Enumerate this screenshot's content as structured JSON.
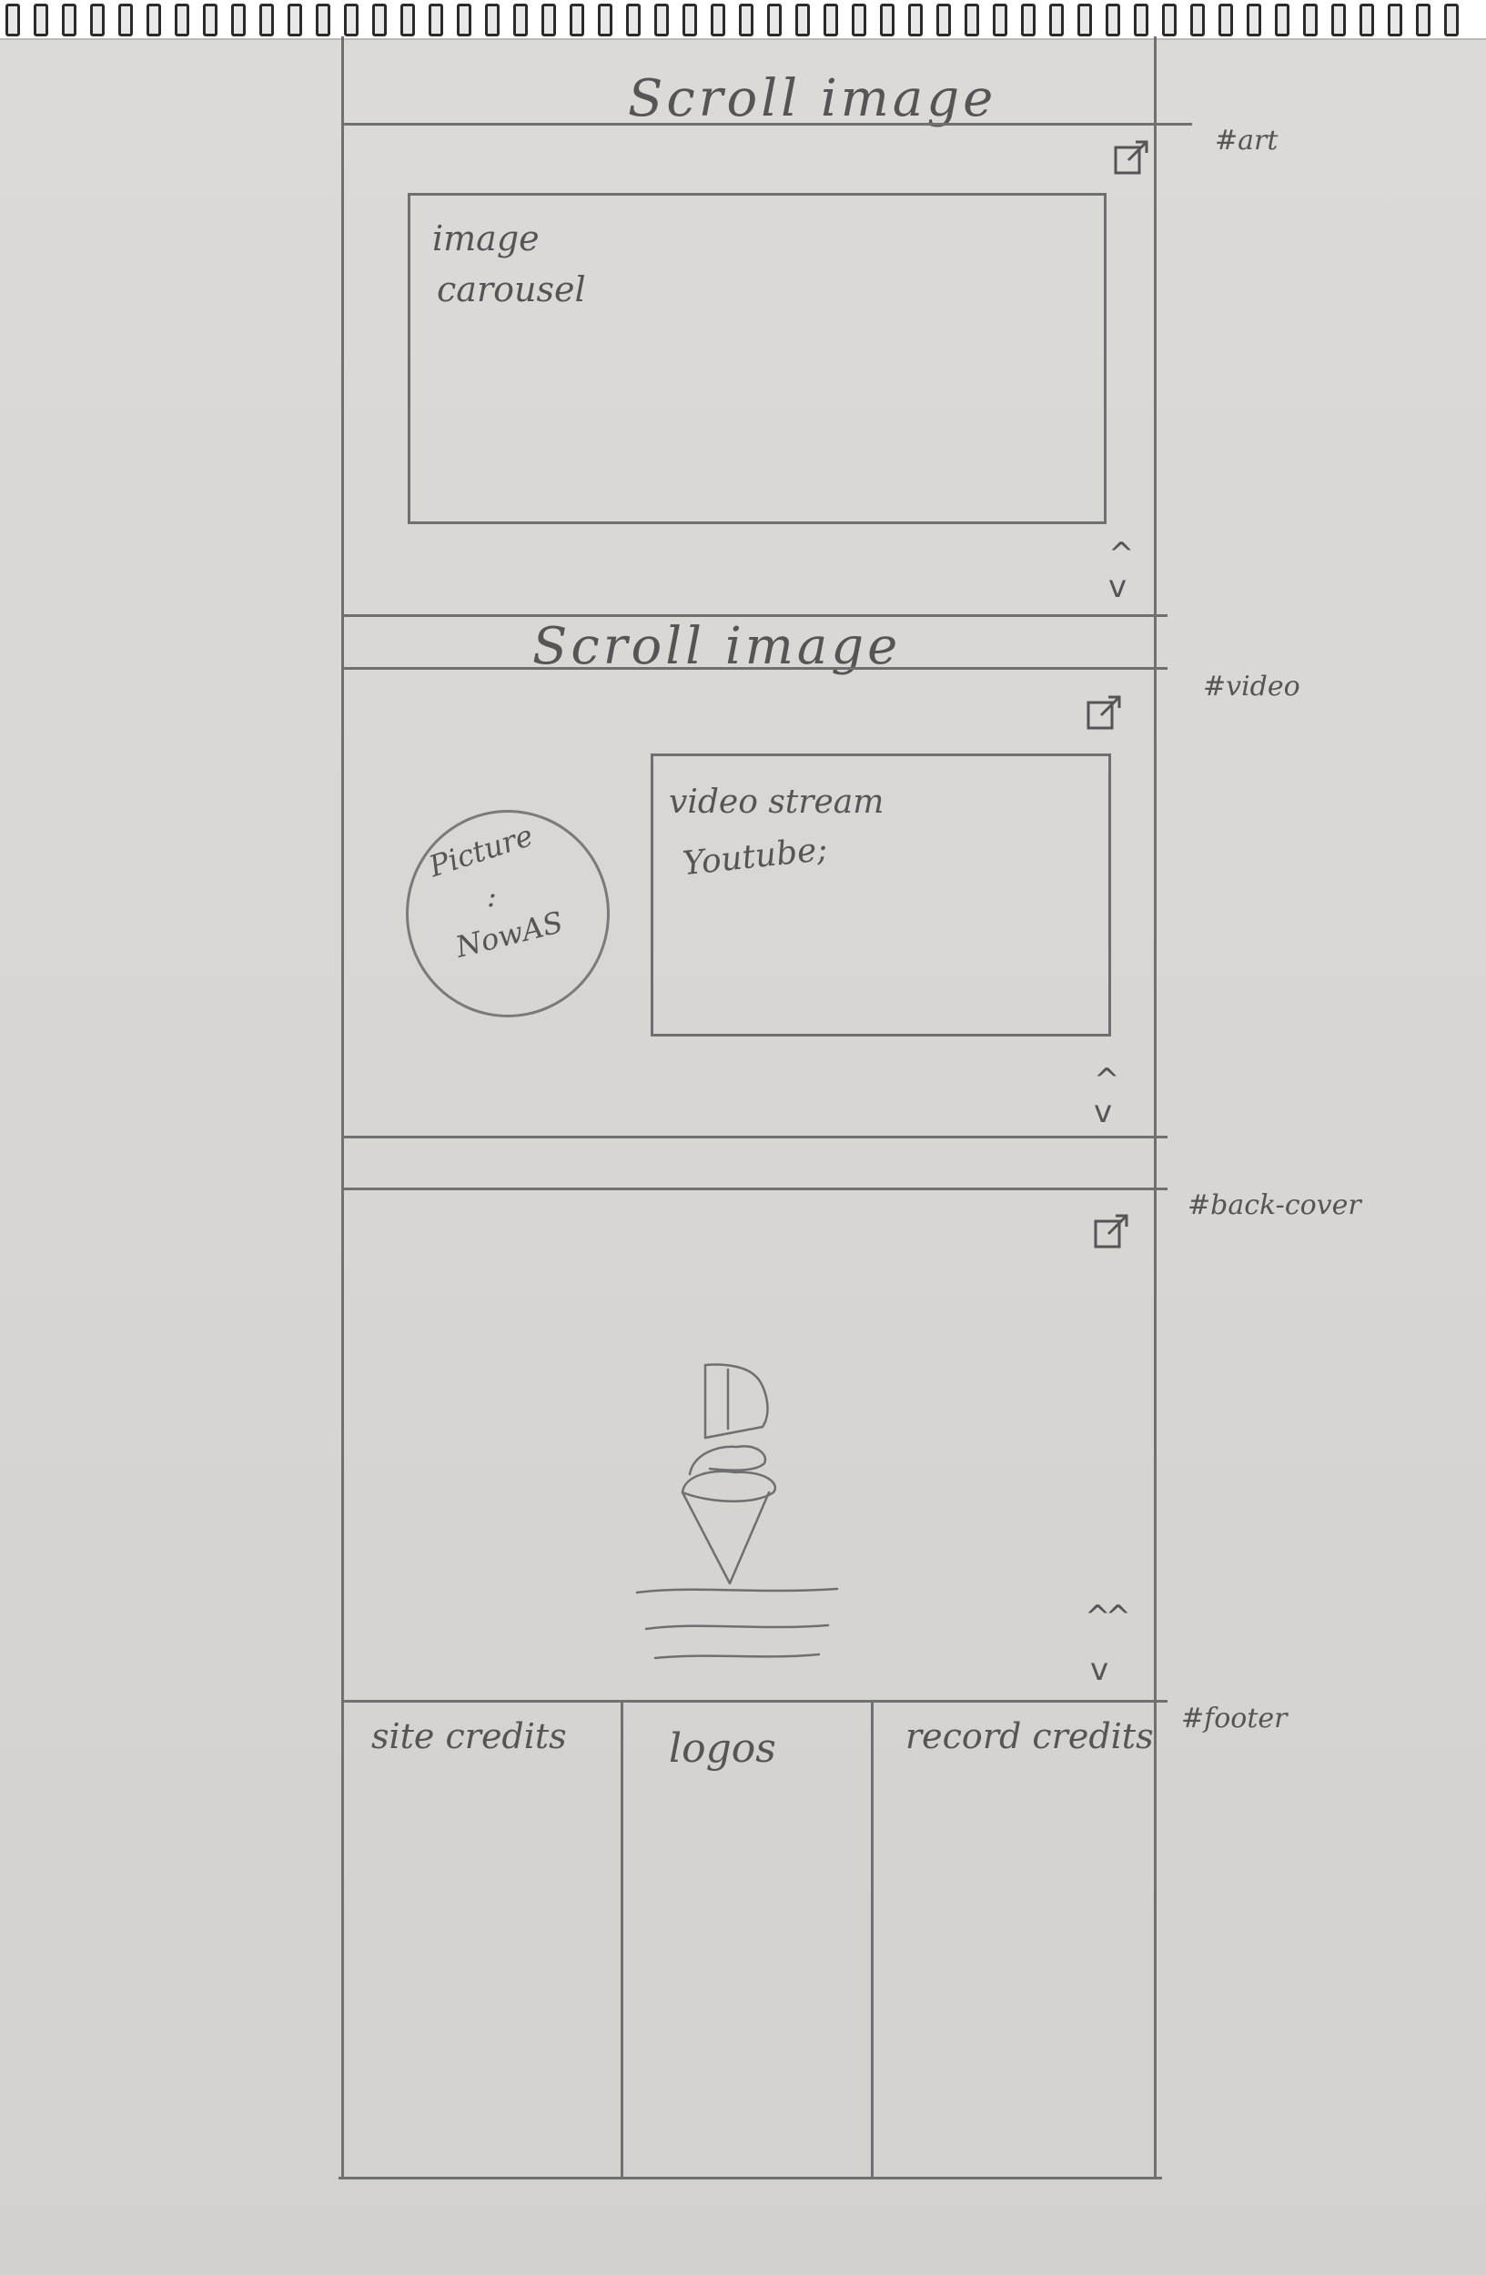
{
  "sections": {
    "art": {
      "header": "Scroll image",
      "tag": "#art",
      "carousel_label_1": "image",
      "carousel_label_2": "carousel"
    },
    "video": {
      "header": "Scroll image",
      "tag": "#video",
      "picture_label_1": "Picture",
      "picture_label_2": ":",
      "picture_label_3": "NowAS",
      "video_label_1": "video stream",
      "video_label_2": "Youtube;"
    },
    "back_cover": {
      "tag": "#back-cover"
    },
    "footer": {
      "tag": "#footer",
      "col_1": "site credits",
      "col_2": "logos",
      "col_3": "record credits"
    }
  },
  "icons": {
    "external_link": "external-link-icon",
    "scroll_up": "chevron-up-icon",
    "scroll_down": "chevron-down-icon",
    "double_up": "double-chevron-up-icon",
    "sketch": "ice-cream-cone-sketch"
  },
  "colors": {
    "paper": "#d8d6d2",
    "pencil": "#6f6f6f"
  }
}
